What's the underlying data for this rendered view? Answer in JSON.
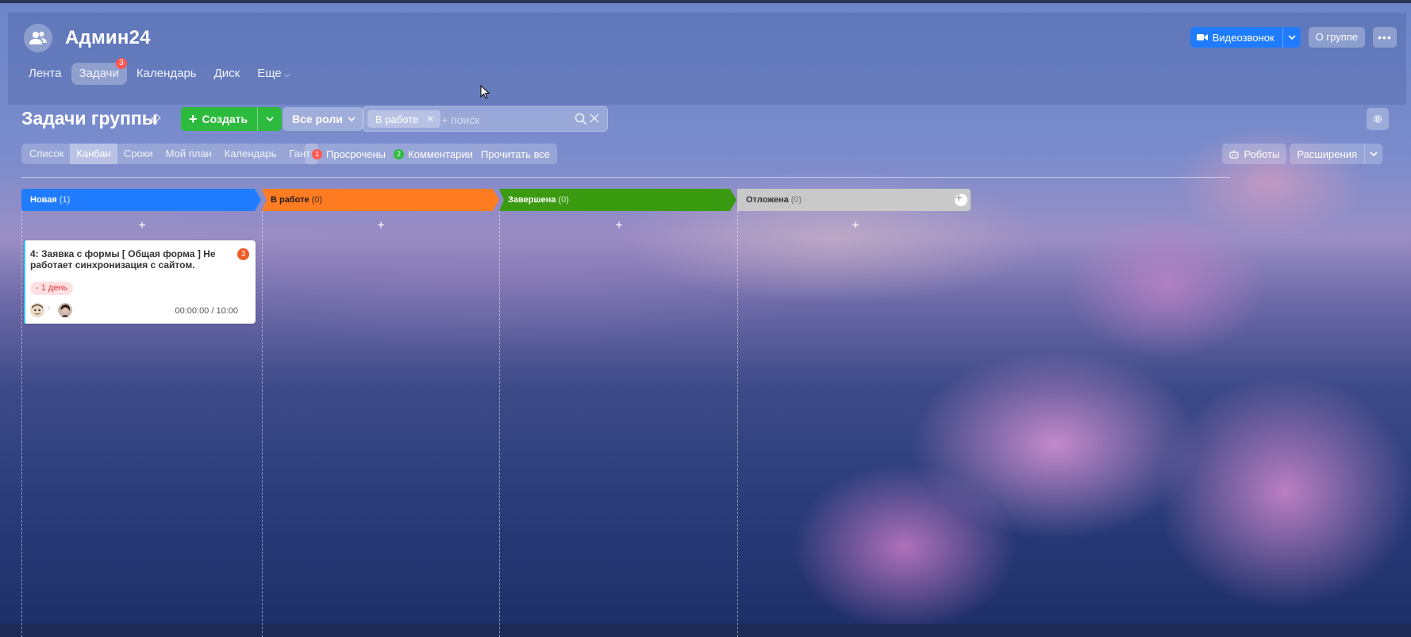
{
  "colors": {
    "accent_blue": "#1f7cff",
    "create_green": "#2cbb3c",
    "badge_red": "#ff5752",
    "stage_new": "#1f7cff",
    "stage_in_progress": "#ff7c23",
    "stage_done": "#3a9a10",
    "stage_deferred": "#c9c9c9"
  },
  "header": {
    "group_icon": "group-icon",
    "group_name": "Админ24",
    "nav": [
      {
        "label": "Лента"
      },
      {
        "label": "Задачи",
        "badge": "3",
        "active": true
      },
      {
        "label": "Календарь"
      },
      {
        "label": "Диск"
      },
      {
        "label": "Еще"
      }
    ],
    "video_call_label": "Видеозвонок",
    "about_group_label": "О группе",
    "more_icon": "ellipsis-icon"
  },
  "toolbar": {
    "title": "Задачи группы",
    "create_label": "Создать",
    "roles_label": "Все роли",
    "filter_chip": "В работе",
    "search_placeholder": "+ поиск"
  },
  "views": [
    {
      "label": "Список"
    },
    {
      "label": "Канбан",
      "active": true
    },
    {
      "label": "Сроки"
    },
    {
      "label": "Мой план"
    },
    {
      "label": "Календарь"
    },
    {
      "label": "Гант"
    }
  ],
  "counters": [
    {
      "count": "1",
      "label": "Просрочены",
      "color": "#ff5752"
    },
    {
      "count": "2",
      "label": "Комментарии",
      "color": "#2cbb3c"
    },
    {
      "label": "Прочитать все"
    }
  ],
  "right_tools": {
    "robots_label": "Роботы",
    "extensions_label": "Расширения"
  },
  "columns": [
    {
      "title": "Новая",
      "count": "(1)",
      "color": "#1f7cff"
    },
    {
      "title": "В работе",
      "count": "(0)",
      "color": "#ff7c23"
    },
    {
      "title": "Завершена",
      "count": "(0)",
      "color": "#3a9a10"
    },
    {
      "title": "Отложена",
      "count": "(0)",
      "color": "#c9c9c9"
    }
  ],
  "add_symbol": "+",
  "card": {
    "title": "4: Заявка с формы [ Общая форма ] Не работает синхронизация с сайтом.",
    "comments": "3",
    "deadline": "- 1 день",
    "time": "00:00:00 / 10:00"
  }
}
